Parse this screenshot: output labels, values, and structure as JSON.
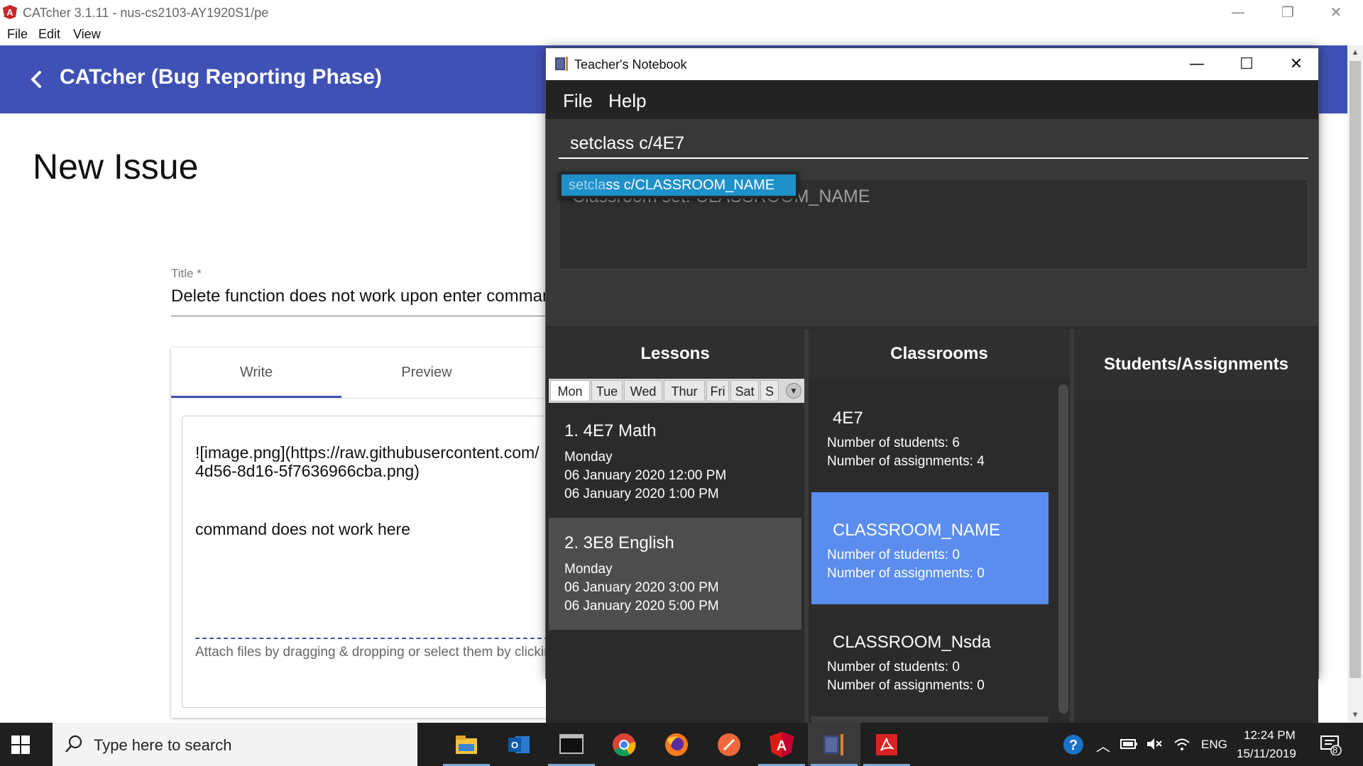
{
  "window": {
    "title": "CATcher 3.1.11 - nus-cs2103-AY1920S1/pe",
    "controls": {
      "minimize": "—",
      "restore": "❐",
      "close": "✕"
    }
  },
  "menubar": [
    "File",
    "Edit",
    "View"
  ],
  "header": {
    "title": "CATcher  (Bug Reporting Phase)",
    "brand_color": "#3f51b5"
  },
  "page": {
    "title": "New Issue",
    "title_field_label": "Title *",
    "title_field_value": "Delete function does not work upon enter command",
    "tabs": [
      {
        "label": "Write",
        "active": true
      },
      {
        "label": "Preview",
        "active": false
      }
    ],
    "description_lines": [
      "![image.png](https://raw.githubusercontent.com/",
      "4d56-8d16-5f7636966cba.png)",
      "command does not work here"
    ],
    "attach_hint": "Attach files by dragging & dropping or select them by clicking here."
  },
  "notebook": {
    "title": "Teacher's Notebook",
    "controls": {
      "minimize": "—",
      "maximize": "☐",
      "close": "✕"
    },
    "menu": [
      "File",
      "Help"
    ],
    "command_input": "setclass c/4E7",
    "result_text": "Classroom set: CLASSROOM_NAME",
    "suggestion": {
      "match": "setcla",
      "rest": "ss c/CLASSROOM_NAME"
    },
    "lessons_header": "Lessons",
    "classrooms_header": "Classrooms",
    "students_header": "Students/Assignments",
    "days": [
      "Mon",
      "Tue",
      "Wed",
      "Thur",
      "Fri",
      "Sat",
      "S"
    ],
    "active_day": "Mon",
    "lessons": [
      {
        "title": "1.  4E7 Math",
        "day": "Monday",
        "start": "06 January 2020 12:00 PM",
        "end": "06 January 2020 1:00 PM"
      },
      {
        "title": "2.  3E8 English",
        "day": "Monday",
        "start": "06 January 2020 3:00 PM",
        "end": "06 January 2020 5:00 PM"
      }
    ],
    "classrooms": [
      {
        "name": "4E7",
        "students": "Number of students: 6",
        "assignments": "Number of assignments: 4",
        "selected": false
      },
      {
        "name": "CLASSROOM_NAME",
        "students": "Number of students: 0",
        "assignments": "Number of assignments: 0",
        "selected": true
      },
      {
        "name": "CLASSROOM_Nsda",
        "students": "Number of students: 0",
        "assignments": "Number of assignments: 0",
        "selected": false
      }
    ],
    "selected_color": "#5b8def"
  },
  "taskbar": {
    "search_placeholder": "Type here to search",
    "apps": [
      "file-explorer",
      "outlook",
      "terminal",
      "chrome",
      "firefox",
      "sublime-text",
      "angular",
      "teachers-notebook",
      "acrobat-reader"
    ],
    "active_app": "teachers-notebook",
    "language": "ENG",
    "time": "12:24 PM",
    "date": "15/11/2019",
    "notifications": "8"
  }
}
